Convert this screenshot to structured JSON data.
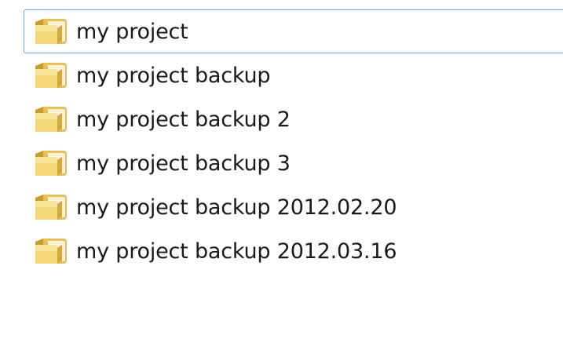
{
  "explorer": {
    "items": [
      {
        "name": "my project",
        "icon": "folder-icon",
        "focused": true
      },
      {
        "name": "my project backup",
        "icon": "folder-icon",
        "focused": false
      },
      {
        "name": "my project backup 2",
        "icon": "folder-icon",
        "focused": false
      },
      {
        "name": "my project backup 3",
        "icon": "folder-icon",
        "focused": false
      },
      {
        "name": "my project backup 2012.02.20",
        "icon": "folder-icon",
        "focused": false
      },
      {
        "name": "my project backup 2012.03.16",
        "icon": "folder-icon",
        "focused": false
      }
    ]
  },
  "colors": {
    "focus_border": "#7da2ce",
    "folder_front": "#f3d36f",
    "folder_back": "#d9a93a",
    "text": "#1a1a1a"
  }
}
